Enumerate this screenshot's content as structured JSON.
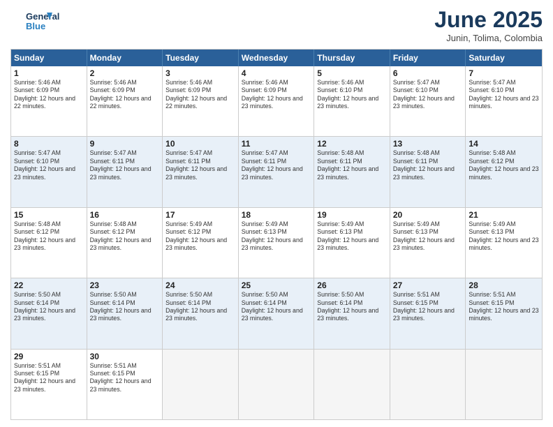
{
  "logo": {
    "line1": "General",
    "line2": "Blue"
  },
  "title": "June 2025",
  "subtitle": "Junin, Tolima, Colombia",
  "days": [
    "Sunday",
    "Monday",
    "Tuesday",
    "Wednesday",
    "Thursday",
    "Friday",
    "Saturday"
  ],
  "rows": [
    [
      {
        "day": "",
        "empty": true
      },
      {
        "day": "1",
        "sunrise": "5:46 AM",
        "sunset": "6:09 PM",
        "daylight": "12 hours and 22 minutes."
      },
      {
        "day": "2",
        "sunrise": "5:46 AM",
        "sunset": "6:09 PM",
        "daylight": "12 hours and 22 minutes."
      },
      {
        "day": "3",
        "sunrise": "5:46 AM",
        "sunset": "6:09 PM",
        "daylight": "12 hours and 22 minutes."
      },
      {
        "day": "4",
        "sunrise": "5:46 AM",
        "sunset": "6:09 PM",
        "daylight": "12 hours and 23 minutes."
      },
      {
        "day": "5",
        "sunrise": "5:46 AM",
        "sunset": "6:10 PM",
        "daylight": "12 hours and 23 minutes."
      },
      {
        "day": "6",
        "sunrise": "5:47 AM",
        "sunset": "6:10 PM",
        "daylight": "12 hours and 23 minutes."
      },
      {
        "day": "7",
        "sunrise": "5:47 AM",
        "sunset": "6:10 PM",
        "daylight": "12 hours and 23 minutes."
      }
    ],
    [
      {
        "day": "8",
        "sunrise": "5:47 AM",
        "sunset": "6:10 PM",
        "daylight": "12 hours and 23 minutes."
      },
      {
        "day": "9",
        "sunrise": "5:47 AM",
        "sunset": "6:11 PM",
        "daylight": "12 hours and 23 minutes."
      },
      {
        "day": "10",
        "sunrise": "5:47 AM",
        "sunset": "6:11 PM",
        "daylight": "12 hours and 23 minutes."
      },
      {
        "day": "11",
        "sunrise": "5:47 AM",
        "sunset": "6:11 PM",
        "daylight": "12 hours and 23 minutes."
      },
      {
        "day": "12",
        "sunrise": "5:48 AM",
        "sunset": "6:11 PM",
        "daylight": "12 hours and 23 minutes."
      },
      {
        "day": "13",
        "sunrise": "5:48 AM",
        "sunset": "6:11 PM",
        "daylight": "12 hours and 23 minutes."
      },
      {
        "day": "14",
        "sunrise": "5:48 AM",
        "sunset": "6:12 PM",
        "daylight": "12 hours and 23 minutes."
      }
    ],
    [
      {
        "day": "15",
        "sunrise": "5:48 AM",
        "sunset": "6:12 PM",
        "daylight": "12 hours and 23 minutes."
      },
      {
        "day": "16",
        "sunrise": "5:48 AM",
        "sunset": "6:12 PM",
        "daylight": "12 hours and 23 minutes."
      },
      {
        "day": "17",
        "sunrise": "5:49 AM",
        "sunset": "6:12 PM",
        "daylight": "12 hours and 23 minutes."
      },
      {
        "day": "18",
        "sunrise": "5:49 AM",
        "sunset": "6:13 PM",
        "daylight": "12 hours and 23 minutes."
      },
      {
        "day": "19",
        "sunrise": "5:49 AM",
        "sunset": "6:13 PM",
        "daylight": "12 hours and 23 minutes."
      },
      {
        "day": "20",
        "sunrise": "5:49 AM",
        "sunset": "6:13 PM",
        "daylight": "12 hours and 23 minutes."
      },
      {
        "day": "21",
        "sunrise": "5:49 AM",
        "sunset": "6:13 PM",
        "daylight": "12 hours and 23 minutes."
      }
    ],
    [
      {
        "day": "22",
        "sunrise": "5:50 AM",
        "sunset": "6:14 PM",
        "daylight": "12 hours and 23 minutes."
      },
      {
        "day": "23",
        "sunrise": "5:50 AM",
        "sunset": "6:14 PM",
        "daylight": "12 hours and 23 minutes."
      },
      {
        "day": "24",
        "sunrise": "5:50 AM",
        "sunset": "6:14 PM",
        "daylight": "12 hours and 23 minutes."
      },
      {
        "day": "25",
        "sunrise": "5:50 AM",
        "sunset": "6:14 PM",
        "daylight": "12 hours and 23 minutes."
      },
      {
        "day": "26",
        "sunrise": "5:50 AM",
        "sunset": "6:14 PM",
        "daylight": "12 hours and 23 minutes."
      },
      {
        "day": "27",
        "sunrise": "5:51 AM",
        "sunset": "6:15 PM",
        "daylight": "12 hours and 23 minutes."
      },
      {
        "day": "28",
        "sunrise": "5:51 AM",
        "sunset": "6:15 PM",
        "daylight": "12 hours and 23 minutes."
      }
    ],
    [
      {
        "day": "29",
        "sunrise": "5:51 AM",
        "sunset": "6:15 PM",
        "daylight": "12 hours and 23 minutes."
      },
      {
        "day": "30",
        "sunrise": "5:51 AM",
        "sunset": "6:15 PM",
        "daylight": "12 hours and 23 minutes."
      },
      {
        "day": "",
        "empty": true
      },
      {
        "day": "",
        "empty": true
      },
      {
        "day": "",
        "empty": true
      },
      {
        "day": "",
        "empty": true
      },
      {
        "day": "",
        "empty": true
      }
    ]
  ]
}
